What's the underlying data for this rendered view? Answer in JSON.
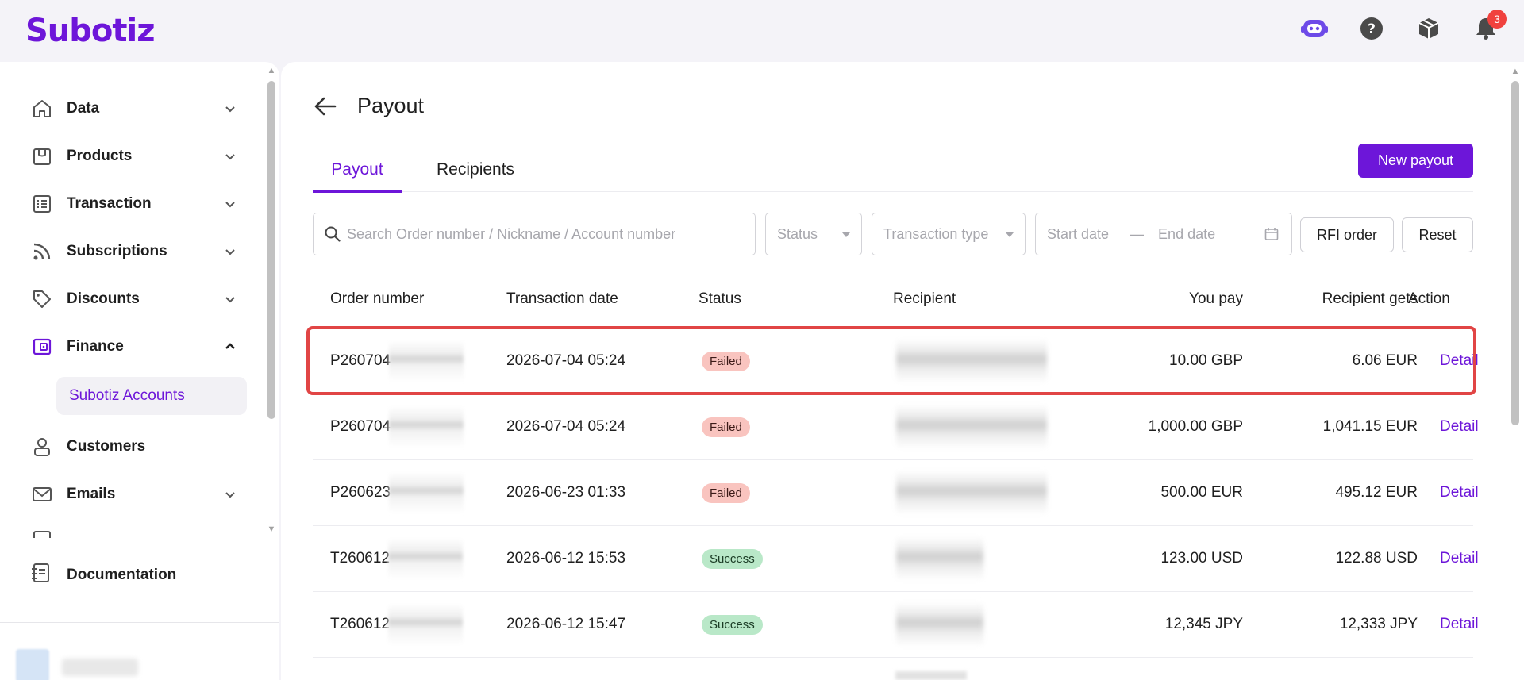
{
  "app": {
    "logo": "Subotiz",
    "notification_count": "3"
  },
  "sidebar": {
    "items": [
      {
        "label": "Data",
        "icon": "home-icon"
      },
      {
        "label": "Products",
        "icon": "store-icon"
      },
      {
        "label": "Transaction",
        "icon": "list-icon"
      },
      {
        "label": "Subscriptions",
        "icon": "rss-icon"
      },
      {
        "label": "Discounts",
        "icon": "tag-icon"
      },
      {
        "label": "Finance",
        "icon": "wallet-icon"
      },
      {
        "label": "Customers",
        "icon": "user-icon"
      },
      {
        "label": "Emails",
        "icon": "mail-icon"
      }
    ],
    "sub_item": "Subotiz Accounts",
    "documentation": "Documentation"
  },
  "page": {
    "title": "Payout",
    "tabs": [
      "Payout",
      "Recipients"
    ],
    "active_tab": "Payout",
    "new_payout_label": "New payout"
  },
  "filters": {
    "search_placeholder": "Search Order number / Nickname / Account number",
    "status_placeholder": "Status",
    "type_placeholder": "Transaction type",
    "start_date": "Start date",
    "date_separator": "—",
    "end_date": "End date",
    "rfi_label": "RFI order",
    "reset_label": "Reset"
  },
  "table": {
    "headers": {
      "order": "Order number",
      "date": "Transaction date",
      "status": "Status",
      "recipient": "Recipient",
      "pay": "You pay",
      "gets": "Recipient gets",
      "action": "Action"
    },
    "rows": [
      {
        "order": "P260704",
        "date": "2026-07-04 05:24",
        "status": "Failed",
        "you_pay": "10.00 GBP",
        "recipient_gets": "6.06 EUR",
        "action": "Detail"
      },
      {
        "order": "P260704",
        "date": "2026-07-04 05:24",
        "status": "Failed",
        "you_pay": "1,000.00 GBP",
        "recipient_gets": "1,041.15 EUR",
        "action": "Detail"
      },
      {
        "order": "P260623",
        "date": "2026-06-23 01:33",
        "status": "Failed",
        "you_pay": "500.00 EUR",
        "recipient_gets": "495.12 EUR",
        "action": "Detail"
      },
      {
        "order": "T260612",
        "date": "2026-06-12 15:53",
        "status": "Success",
        "you_pay": "123.00 USD",
        "recipient_gets": "122.88 USD",
        "action": "Detail"
      },
      {
        "order": "T260612",
        "date": "2026-06-12 15:47",
        "status": "Success",
        "you_pay": "12,345 JPY",
        "recipient_gets": "12,333 JPY",
        "action": "Detail"
      }
    ]
  },
  "colors": {
    "accent": "#6d16d9",
    "failed_bg": "#f9c4bf",
    "success_bg": "#b9e8c8",
    "highlight": "#e14545"
  }
}
